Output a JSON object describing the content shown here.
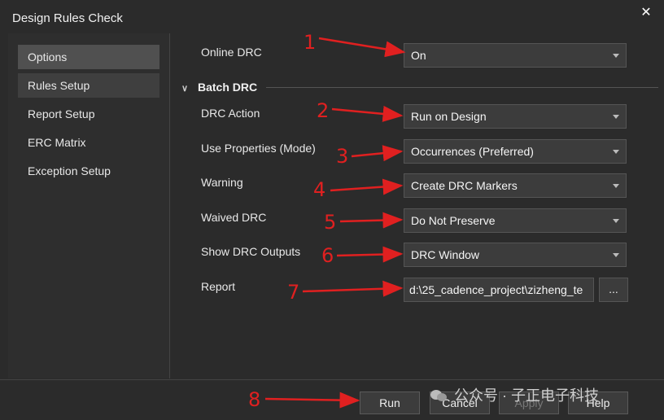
{
  "window": {
    "title": "Design Rules Check",
    "close_glyph": "✕"
  },
  "sidebar": {
    "items": [
      {
        "label": "Options"
      },
      {
        "label": "Rules Setup"
      },
      {
        "label": "Report Setup"
      },
      {
        "label": "ERC Matrix"
      },
      {
        "label": "Exception Setup"
      }
    ]
  },
  "options": {
    "online_drc": {
      "label": "Online DRC",
      "value": "On"
    },
    "batch_section": "Batch DRC",
    "drc_action": {
      "label": "DRC Action",
      "value": "Run on Design"
    },
    "use_properties": {
      "label": "Use Properties (Mode)",
      "value": "Occurrences (Preferred)"
    },
    "warning": {
      "label": "Warning",
      "value": "Create DRC Markers"
    },
    "waived_drc": {
      "label": "Waived DRC",
      "value": "Do Not Preserve"
    },
    "show_outputs": {
      "label": "Show DRC Outputs",
      "value": "DRC Window"
    },
    "report": {
      "label": "Report",
      "value": "d:\\25_cadence_project\\zizheng_te",
      "browse": "..."
    }
  },
  "buttons": {
    "run": "Run",
    "cancel": "Cancel",
    "apply": "Apply",
    "help": "Help"
  },
  "annotations": {
    "n1": "1",
    "n2": "2",
    "n3": "3",
    "n4": "4",
    "n5": "5",
    "n6": "6",
    "n7": "7",
    "n8": "8"
  },
  "watermark": "公众号 · 子正电子科技",
  "colors": {
    "background": "#2b2b2b",
    "selected": "#505050",
    "annotation": "#e02020"
  }
}
